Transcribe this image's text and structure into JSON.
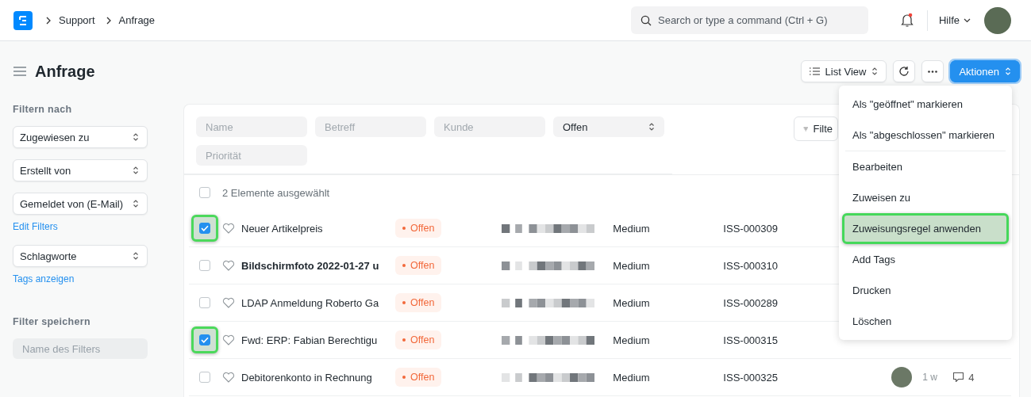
{
  "breadcrumbs": [
    "Support",
    "Anfrage"
  ],
  "search": {
    "placeholder": "Search or type a command (Ctrl + G)"
  },
  "notifications": {
    "unread": true
  },
  "help_menu": "Hilfe",
  "page_title": "Anfrage",
  "toolbar": {
    "view": "List View",
    "actions": "Aktionen"
  },
  "sidebar": {
    "heading": "Filtern nach",
    "filters": [
      "Zugewiesen zu",
      "Erstellt von",
      "Gemeldet von (E-Mail)"
    ],
    "edit_filters": "Edit Filters",
    "tags": "Schlagworte",
    "show_tags": "Tags anzeigen",
    "save_heading": "Filter speichern",
    "save_placeholder": "Name des Filters"
  },
  "filters": {
    "fields": [
      {
        "kind": "text",
        "placeholder": "Name"
      },
      {
        "kind": "text",
        "placeholder": "Betreff"
      },
      {
        "kind": "text",
        "placeholder": "Kunde"
      },
      {
        "kind": "select",
        "value": "Offen"
      },
      {
        "kind": "text",
        "placeholder": "Priorität"
      }
    ],
    "filter_button": "Filte"
  },
  "list": {
    "selection_label": "2 Elemente ausgewählt",
    "all_checked": false,
    "rows": [
      {
        "checked": true,
        "highlighted": true,
        "unread": false,
        "subject": "Neuer Artikelpreis",
        "status": "Offen",
        "priority": "Medium",
        "id": "ISS-000309"
      },
      {
        "checked": false,
        "highlighted": false,
        "unread": true,
        "subject": "Bildschirmfoto 2022-01-27 u",
        "status": "Offen",
        "priority": "Medium",
        "id": "ISS-000310"
      },
      {
        "checked": false,
        "highlighted": false,
        "unread": false,
        "subject": "LDAP Anmeldung Roberto Ga",
        "status": "Offen",
        "priority": "Medium",
        "id": "ISS-000289"
      },
      {
        "checked": true,
        "highlighted": true,
        "unread": false,
        "subject": "Fwd: ERP: Fabian Berechtigu",
        "status": "Offen",
        "priority": "Medium",
        "id": "ISS-000315"
      },
      {
        "checked": false,
        "highlighted": false,
        "unread": false,
        "subject": "Debitorenkonto in Rechnung",
        "status": "Offen",
        "priority": "Medium",
        "id": "ISS-000325",
        "time": "1 w",
        "comments": "4"
      }
    ]
  },
  "menu": {
    "items": [
      {
        "label": "Als \"geöffnet\" markieren",
        "highlighted": false,
        "divider_after": false
      },
      {
        "label": "Als \"abgeschlossen\" markieren",
        "highlighted": false,
        "divider_after": true
      },
      {
        "label": "Bearbeiten",
        "highlighted": false,
        "divider_after": false
      },
      {
        "label": "Zuweisen zu",
        "highlighted": false,
        "divider_after": false
      },
      {
        "label": "Zuweisungsregel anwenden",
        "highlighted": true,
        "divider_after": false
      },
      {
        "label": "Add Tags",
        "highlighted": false,
        "divider_after": false
      },
      {
        "label": "Drucken",
        "highlighted": false,
        "divider_after": false
      },
      {
        "label": "Löschen",
        "highlighted": false,
        "divider_after": false
      }
    ]
  }
}
